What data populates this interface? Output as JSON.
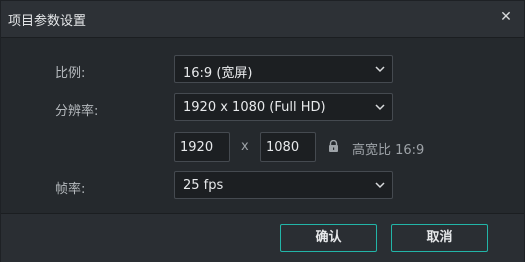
{
  "dialog": {
    "title": "项目参数设置",
    "close_icon": "close-icon"
  },
  "form": {
    "aspect_label": "比例:",
    "aspect_value": "16:9 (宽屏)",
    "resolution_label": "分辨率:",
    "resolution_value": "1920 x 1080 (Full HD)",
    "width_value": "1920",
    "times_sign": "x",
    "height_value": "1080",
    "lock_icon": "lock-icon",
    "ratio_text": "高宽比 16:9",
    "framerate_label": "帧率:",
    "framerate_value": "25 fps"
  },
  "footer": {
    "ok_label": "确认",
    "cancel_label": "取消"
  },
  "colors": {
    "accent": "#22b5a8",
    "background": "#2a2e33",
    "field_bg": "#1c1f22"
  }
}
